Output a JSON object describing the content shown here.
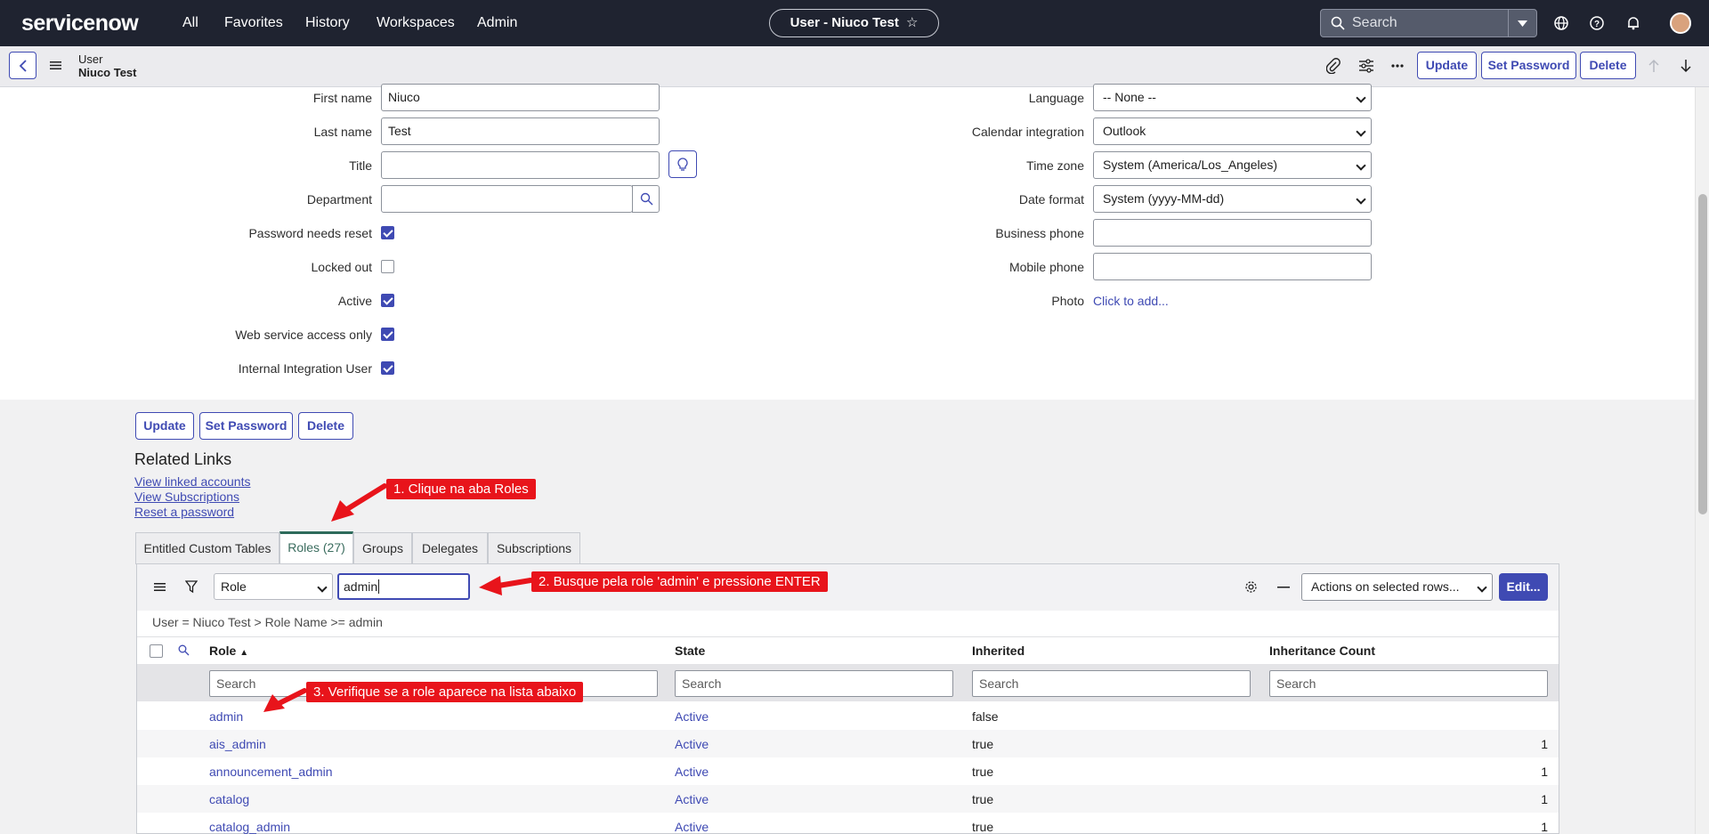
{
  "topnav": {
    "logo": "servicenow",
    "menu": [
      "All",
      "Favorites",
      "History",
      "Workspaces",
      "Admin"
    ],
    "record_title": "User - Niuco Test",
    "search_placeholder": "Search"
  },
  "formbar": {
    "table_label": "User",
    "record_label": "Niuco Test",
    "update_label": "Update",
    "set_password_label": "Set Password",
    "delete_label": "Delete"
  },
  "form": {
    "first_name_label": "First name",
    "first_name_value": "Niuco",
    "last_name_label": "Last name",
    "last_name_value": "Test",
    "title_label": "Title",
    "title_value": "",
    "department_label": "Department",
    "department_value": "",
    "password_reset_label": "Password needs reset",
    "password_reset_checked": true,
    "locked_out_label": "Locked out",
    "locked_out_checked": false,
    "active_label": "Active",
    "active_checked": true,
    "web_service_label": "Web service access only",
    "web_service_checked": true,
    "internal_integration_label": "Internal Integration User",
    "internal_integration_checked": true,
    "language_label": "Language",
    "language_value": "-- None --",
    "calendar_label": "Calendar integration",
    "calendar_value": "Outlook",
    "timezone_label": "Time zone",
    "timezone_value": "System (America/Los_Angeles)",
    "dateformat_label": "Date format",
    "dateformat_value": "System (yyyy-MM-dd)",
    "business_phone_label": "Business phone",
    "business_phone_value": "",
    "mobile_phone_label": "Mobile phone",
    "mobile_phone_value": "",
    "photo_label": "Photo",
    "photo_link": "Click to add..."
  },
  "bottom_buttons": {
    "update": "Update",
    "set_password": "Set Password",
    "delete": "Delete"
  },
  "related_links": {
    "heading": "Related Links",
    "links": [
      "View linked accounts",
      "View Subscriptions",
      "Reset a password"
    ]
  },
  "tabs": [
    "Entitled Custom Tables",
    "Roles (27)",
    "Groups",
    "Delegates",
    "Subscriptions"
  ],
  "list": {
    "search_field": "Role",
    "search_value": "admin",
    "actions_select": "Actions on selected rows...",
    "edit_label": "Edit...",
    "breadcrumb": "User = Niuco Test  >  Role Name >= admin",
    "columns": [
      "Role",
      "State",
      "Inherited",
      "Inheritance Count"
    ],
    "search_placeholder": "Search",
    "rows": [
      {
        "role": "admin",
        "state": "Active",
        "inherited": "false",
        "count": ""
      },
      {
        "role": "ais_admin",
        "state": "Active",
        "inherited": "true",
        "count": "1"
      },
      {
        "role": "announcement_admin",
        "state": "Active",
        "inherited": "true",
        "count": "1"
      },
      {
        "role": "catalog",
        "state": "Active",
        "inherited": "true",
        "count": "1"
      },
      {
        "role": "catalog_admin",
        "state": "Active",
        "inherited": "true",
        "count": "1"
      }
    ]
  },
  "annotations": {
    "step1": "1. Clique na aba Roles",
    "step2": "2. Busque pela role 'admin' e pressione ENTER",
    "step3": "3. Verifique se a role aparece na lista abaixo"
  },
  "colors": {
    "nav_bg": "#1f2330",
    "primary": "#3f4ab3",
    "annotation": "#e8141b",
    "tab_active": "#2d6b5b"
  }
}
